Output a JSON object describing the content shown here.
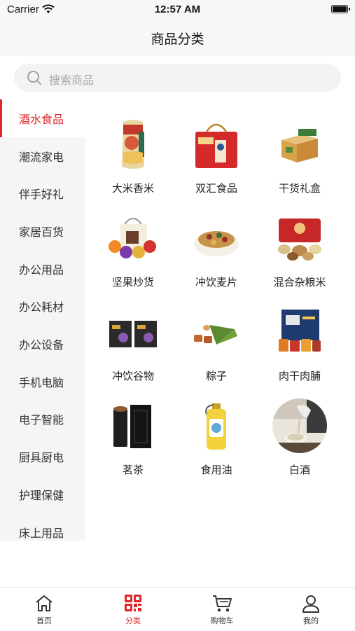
{
  "status": {
    "carrier": "Carrier",
    "time": "12:57 AM"
  },
  "nav": {
    "title": "商品分类"
  },
  "search": {
    "placeholder": "搜索商品"
  },
  "sidebar": {
    "items": [
      {
        "label": "酒水食品",
        "active": true
      },
      {
        "label": "潮流家电"
      },
      {
        "label": "伴手好礼"
      },
      {
        "label": "家居百货"
      },
      {
        "label": "办公用品"
      },
      {
        "label": "办公耗材"
      },
      {
        "label": "办公设备"
      },
      {
        "label": "手机电脑"
      },
      {
        "label": "电子智能"
      },
      {
        "label": "厨具厨电"
      },
      {
        "label": "护理保健"
      },
      {
        "label": "床上用品"
      }
    ]
  },
  "categories": [
    {
      "label": "大米香米",
      "icon": "rice-package-icon"
    },
    {
      "label": "双汇食品",
      "icon": "gift-bag-icon"
    },
    {
      "label": "干货礼盒",
      "icon": "gift-box-icon"
    },
    {
      "label": "坚果炒货",
      "icon": "nuts-bag-icon"
    },
    {
      "label": "冲饮麦片",
      "icon": "cereal-bowl-icon"
    },
    {
      "label": "混合杂粮米",
      "icon": "grain-box-icon"
    },
    {
      "label": "冲饮谷物",
      "icon": "grain-drink-box-icon"
    },
    {
      "label": "粽子",
      "icon": "zongzi-icon"
    },
    {
      "label": "肉干肉脯",
      "icon": "jerky-box-icon"
    },
    {
      "label": "茗茶",
      "icon": "tea-canister-icon"
    },
    {
      "label": "食用油",
      "icon": "oil-bottle-icon"
    },
    {
      "label": "白酒",
      "icon": "liquor-pour-icon"
    }
  ],
  "tabbar": {
    "items": [
      {
        "label": "首页",
        "icon": "home-icon"
      },
      {
        "label": "分类",
        "icon": "category-grid-icon",
        "active": true
      },
      {
        "label": "购物车",
        "icon": "cart-icon"
      },
      {
        "label": "我的",
        "icon": "user-icon"
      }
    ]
  },
  "colors": {
    "accent": "#e0262b",
    "sidebar_bg": "#f5f5f5",
    "search_bg": "#f3f3f3"
  }
}
